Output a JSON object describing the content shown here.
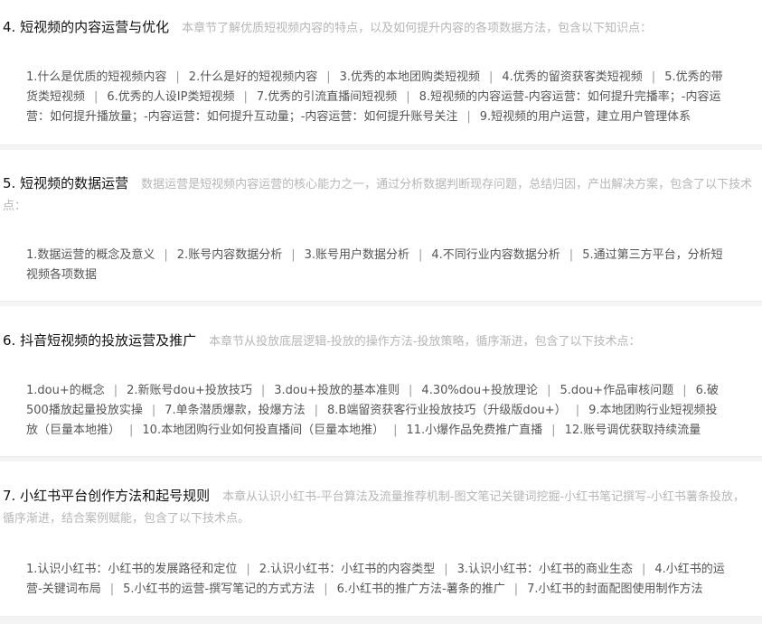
{
  "chapters": [
    {
      "title": "4. 短视频的内容运营与优化",
      "desc": "本章节了解优质短视频内容的特点，以及如何提升内容的各项数据方法，包含以下知识点：",
      "topics": [
        "1.什么是优质的短视频内容",
        "2.什么是好的短视频内容",
        "3.优秀的本地团购类短视频",
        "4.优秀的留资获客类短视频",
        "5.优秀的带货类短视频",
        "6.优秀的人设IP类短视频",
        "7.优秀的引流直播间短视频",
        "8.短视频的内容运营-内容运营：如何提升完播率；-内容运营：如何提升播放量；-内容运营：如何提升互动量；-内容运营：如何提升账号关注",
        "9.短视频的用户运营，建立用户管理体系"
      ]
    },
    {
      "title": "5. 短视频的数据运营",
      "desc": "数据运营是短视频内容运营的核心能力之一，通过分析数据判断现存问题，总结归因，产出解决方案，包含了以下技术点：",
      "topics": [
        "1.数据运营的概念及意义",
        "2.账号内容数据分析",
        "3.账号用户数据分析",
        "4.不同行业内容数据分析",
        "5.通过第三方平台，分析短视频各项数据"
      ]
    },
    {
      "title": "6. 抖音短视频的投放运营及推广",
      "desc": "本章节从投放底层逻辑-投放的操作方法-投放策略，循序渐进，包含了以下技术点：",
      "topics": [
        "1.dou+的概念",
        "2.新账号dou+投放技巧",
        "3.dou+投放的基本准则",
        "4.30%dou+投放理论",
        "5.dou+作品审核问题",
        "6.破500播放起量投放实操",
        "7.单条潜质爆款，投爆方法",
        "8.B端留资获客行业投放技巧（升级版dou+）",
        "9.本地团购行业短视频投放（巨量本地推）",
        "10.本地团购行业如何投直播间（巨量本地推）",
        "11.小爆作品免费推广直播",
        "12.账号调优获取持续流量"
      ]
    },
    {
      "title": "7. 小红书平台创作方法和起号规则",
      "desc": "本章从认识小红书-平台算法及流量推荐机制-图文笔记关键词挖掘-小红书笔记撰写-小红书薯条投放，循序渐进，结合案例赋能，包含了以下技术点。",
      "topics": [
        "1.认识小红书：小红书的发展路径和定位",
        "2.认识小红书：小红书的内容类型",
        "3.认识小红书：小红书的商业生态",
        "4.小红书的运营-关键词布局",
        "5.小红书的运营-撰写笔记的方式方法",
        "6.小红书的推广方法-薯条的推广",
        "7.小红书的封面配图使用制作方法"
      ]
    }
  ],
  "separator": "|"
}
